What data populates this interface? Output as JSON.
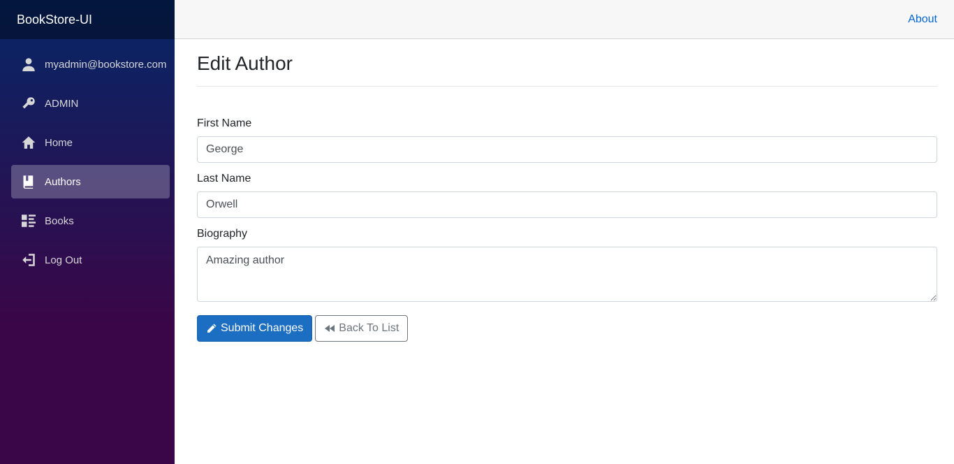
{
  "app": {
    "brand": "BookStore-UI"
  },
  "topbar": {
    "about_label": "About"
  },
  "sidebar": {
    "items": [
      {
        "label": "myadmin@bookstore.com",
        "icon": "person-icon"
      },
      {
        "label": "ADMIN",
        "icon": "key-icon"
      },
      {
        "label": "Home",
        "icon": "home-icon"
      },
      {
        "label": "Authors",
        "icon": "book-icon",
        "active": true
      },
      {
        "label": "Books",
        "icon": "list-icon"
      },
      {
        "label": "Log Out",
        "icon": "logout-icon"
      }
    ]
  },
  "page": {
    "title": "Edit Author"
  },
  "form": {
    "first_name": {
      "label": "First Name",
      "value": "George"
    },
    "last_name": {
      "label": "Last Name",
      "value": "Orwell"
    },
    "biography": {
      "label": "Biography",
      "value": "Amazing author"
    },
    "submit_label": "Submit Changes",
    "back_label": "Back To List"
  },
  "colors": {
    "primary": "#1b6ec2",
    "link": "#0366d6",
    "sidebar_top": "#052767",
    "sidebar_bottom": "#3a0647"
  }
}
